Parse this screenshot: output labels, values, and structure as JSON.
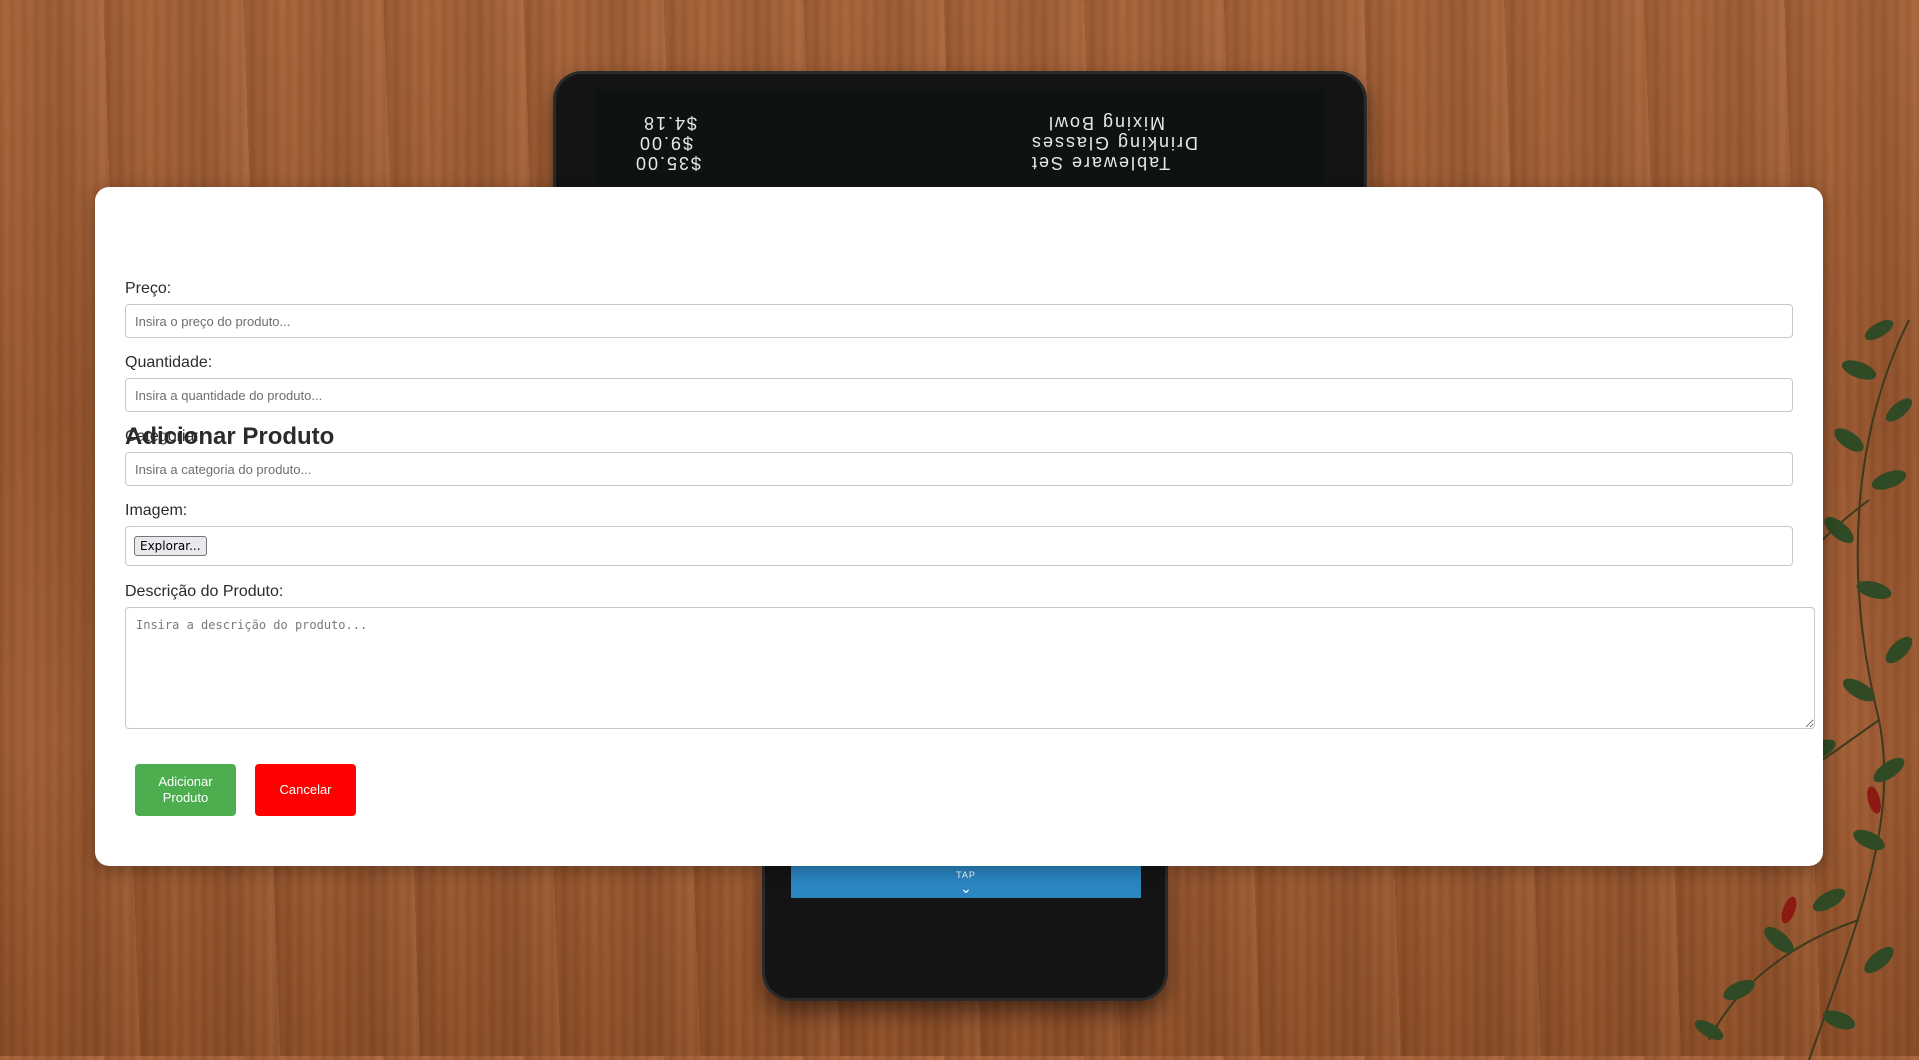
{
  "background": {
    "receipt_items": [
      {
        "name": "Tableware Set",
        "price": "$35.00"
      },
      {
        "name": "Drinking Glasses",
        "price": "$9.00"
      },
      {
        "name": "Mixing Bowl",
        "price": "$4.18"
      }
    ],
    "tap_label": "TAP"
  },
  "form": {
    "title": "Adicionar Produto",
    "price_label": "Preço:",
    "price_placeholder": "Insira o preço do produto...",
    "quantity_label": "Quantidade:",
    "quantity_placeholder": "Insira a quantidade do produto...",
    "category_label": "Categoria:",
    "category_placeholder": "Insira a categoria do produto...",
    "image_label": "Imagem:",
    "file_button_label": "Explorar...",
    "description_label": "Descrição do Produto:",
    "description_placeholder": "Insira a descrição do produto...",
    "submit_label": "Adicionar Produto",
    "cancel_label": "Cancelar"
  },
  "colors": {
    "submit_button": "#4cae4f",
    "cancel_button": "#ff0000",
    "modal_background": "#ffffff"
  }
}
